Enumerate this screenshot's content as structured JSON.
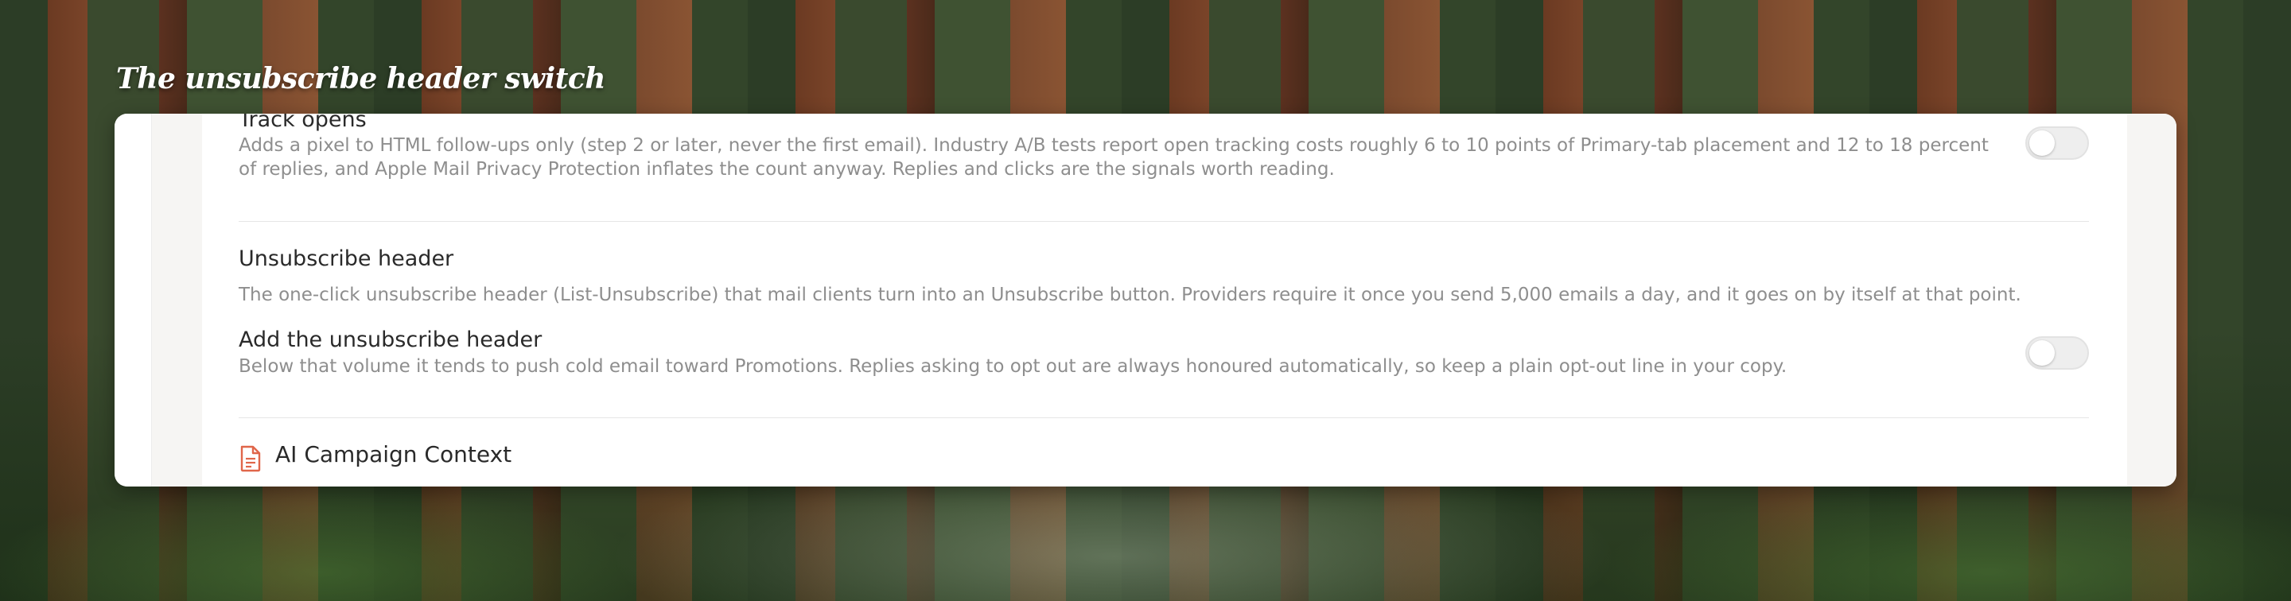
{
  "caption": "The unsubscribe header switch",
  "track_opens": {
    "title": "Track opens",
    "description": "Adds a pixel to HTML follow-ups only (step 2 or later, never the first email). Industry A/B tests report open tracking costs roughly 6 to 10 points of Primary-tab placement and 12 to 18 percent of replies, and Apple Mail Privacy Protection inflates the count anyway. Replies and clicks are the signals worth reading.",
    "enabled": false
  },
  "unsubscribe_section": {
    "title": "Unsubscribe header",
    "description": "The one-click unsubscribe header (List-Unsubscribe) that mail clients turn into an Unsubscribe button. Providers require it once you send 5,000 emails a day, and it goes on by itself at that point."
  },
  "add_unsubscribe": {
    "title": "Add the unsubscribe header",
    "description": "Below that volume it tends to push cold email toward Promotions. Replies asking to opt out are always honoured automatically, so keep a plain opt-out line in your copy.",
    "enabled": false
  },
  "ai_context": {
    "title": "AI Campaign Context",
    "icon": "document-icon"
  },
  "colors": {
    "accent_icon": "#e0664a",
    "toggle_off": "#eeeeee"
  }
}
